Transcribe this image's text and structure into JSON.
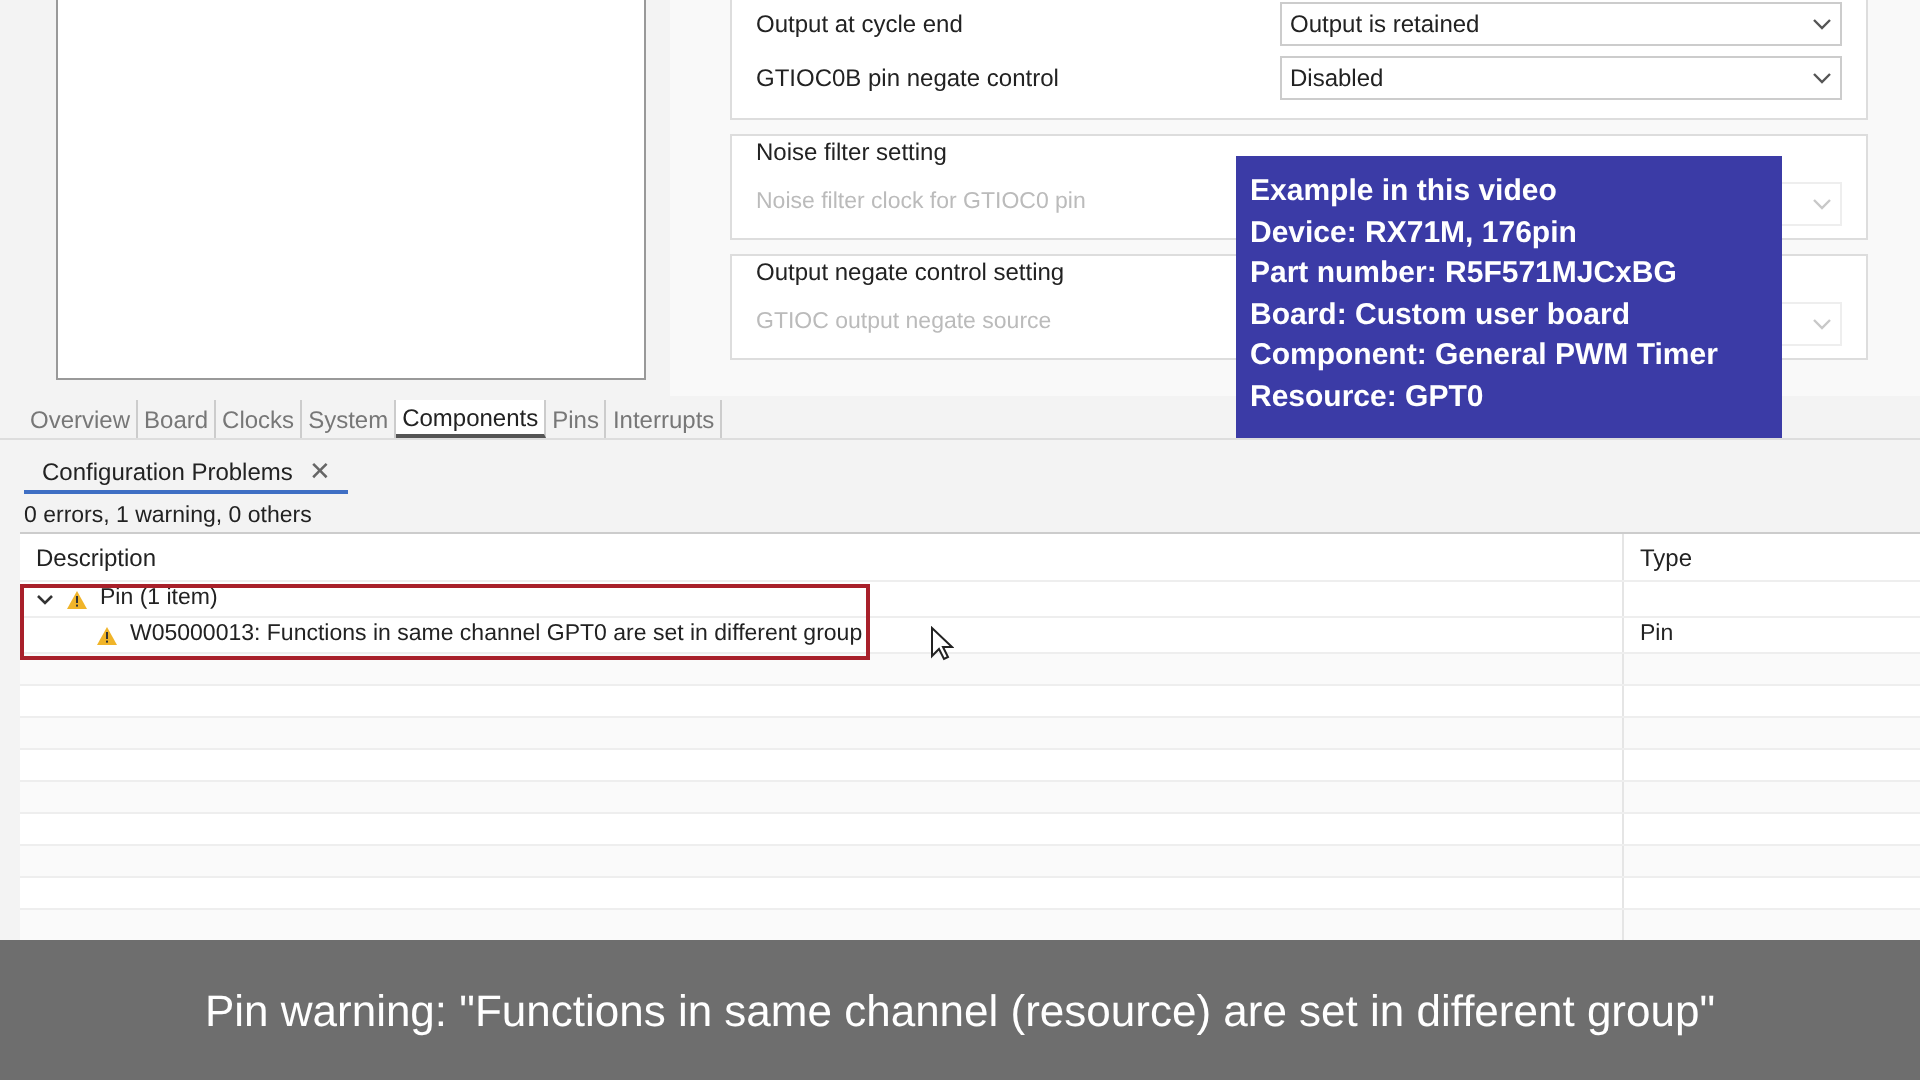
{
  "settings": {
    "rows": [
      {
        "label": "Output at cycle end",
        "value": "Output is retained"
      },
      {
        "label": "GTIOC0B pin negate control",
        "value": "Disabled"
      }
    ],
    "groups": [
      {
        "title": "Noise filter setting",
        "rows": [
          {
            "label": "Noise filter clock for GTIOC0 pin",
            "disabled": true
          }
        ]
      },
      {
        "title": "Output negate control setting",
        "rows": [
          {
            "label": "GTIOC output negate source",
            "disabled": true
          }
        ]
      }
    ]
  },
  "editor_tabs": [
    {
      "label": "Overview",
      "selected": false
    },
    {
      "label": "Board",
      "selected": false
    },
    {
      "label": "Clocks",
      "selected": false
    },
    {
      "label": "System",
      "selected": false
    },
    {
      "label": "Components",
      "selected": true
    },
    {
      "label": "Pins",
      "selected": false
    },
    {
      "label": "Interrupts",
      "selected": false
    }
  ],
  "problems": {
    "tab": "Configuration Problems",
    "close": "✕",
    "summary": "0 errors, 1 warning, 0 others",
    "columns": [
      "Description",
      "Type"
    ],
    "tree": [
      {
        "label": "Pin (1 item)",
        "expanded": true,
        "children": [
          {
            "label": "W05000013: Functions in same channel GPT0 are set in different group",
            "type": "Pin"
          }
        ]
      }
    ]
  },
  "info_box": {
    "lines": [
      "Example in this video",
      "Device: RX71M, 176pin",
      "Part number: R5F571MJCxBG",
      "Board: Custom user board",
      "Component: General PWM Timer",
      "Resource: GPT0"
    ]
  },
  "caption": "Pin warning: \"Functions in same channel (resource) are set in different group\""
}
